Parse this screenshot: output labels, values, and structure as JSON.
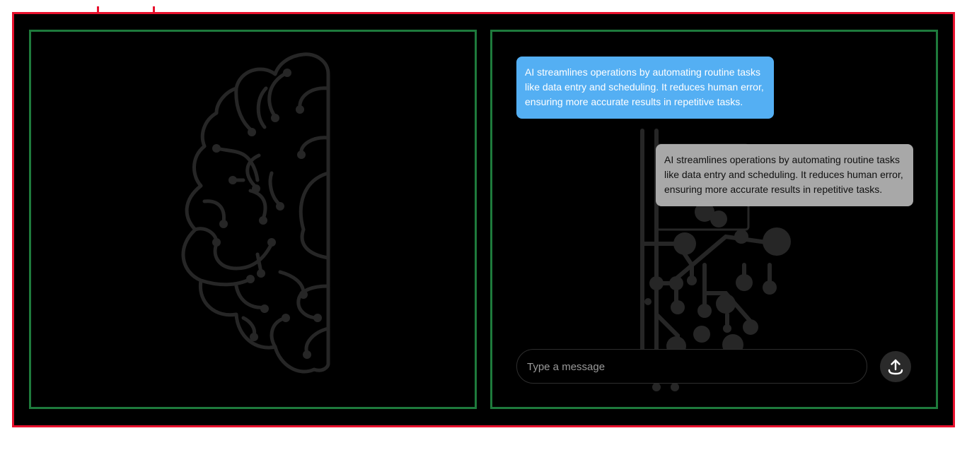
{
  "chat": {
    "messages": [
      {
        "role": "ai",
        "text": "AI streamlines operations by automating routine tasks like data entry and scheduling. It reduces human error, ensuring more accurate results in repetitive tasks."
      },
      {
        "role": "user",
        "text": "AI streamlines operations by automating routine tasks like data entry and scheduling. It reduces human error, ensuring more accurate results in repetitive tasks."
      }
    ],
    "input": {
      "value": "",
      "placeholder": "Type a message"
    }
  },
  "icons": {
    "send": "upload-arrow-icon",
    "brain": "brain-circuit-icon",
    "circuit": "circuit-board-icon"
  },
  "colors": {
    "frame_border": "#e8112d",
    "panel_border": "#1e7a3c",
    "ai_bubble": "#54aff3",
    "user_bubble": "#afafaf",
    "background": "#000000"
  }
}
